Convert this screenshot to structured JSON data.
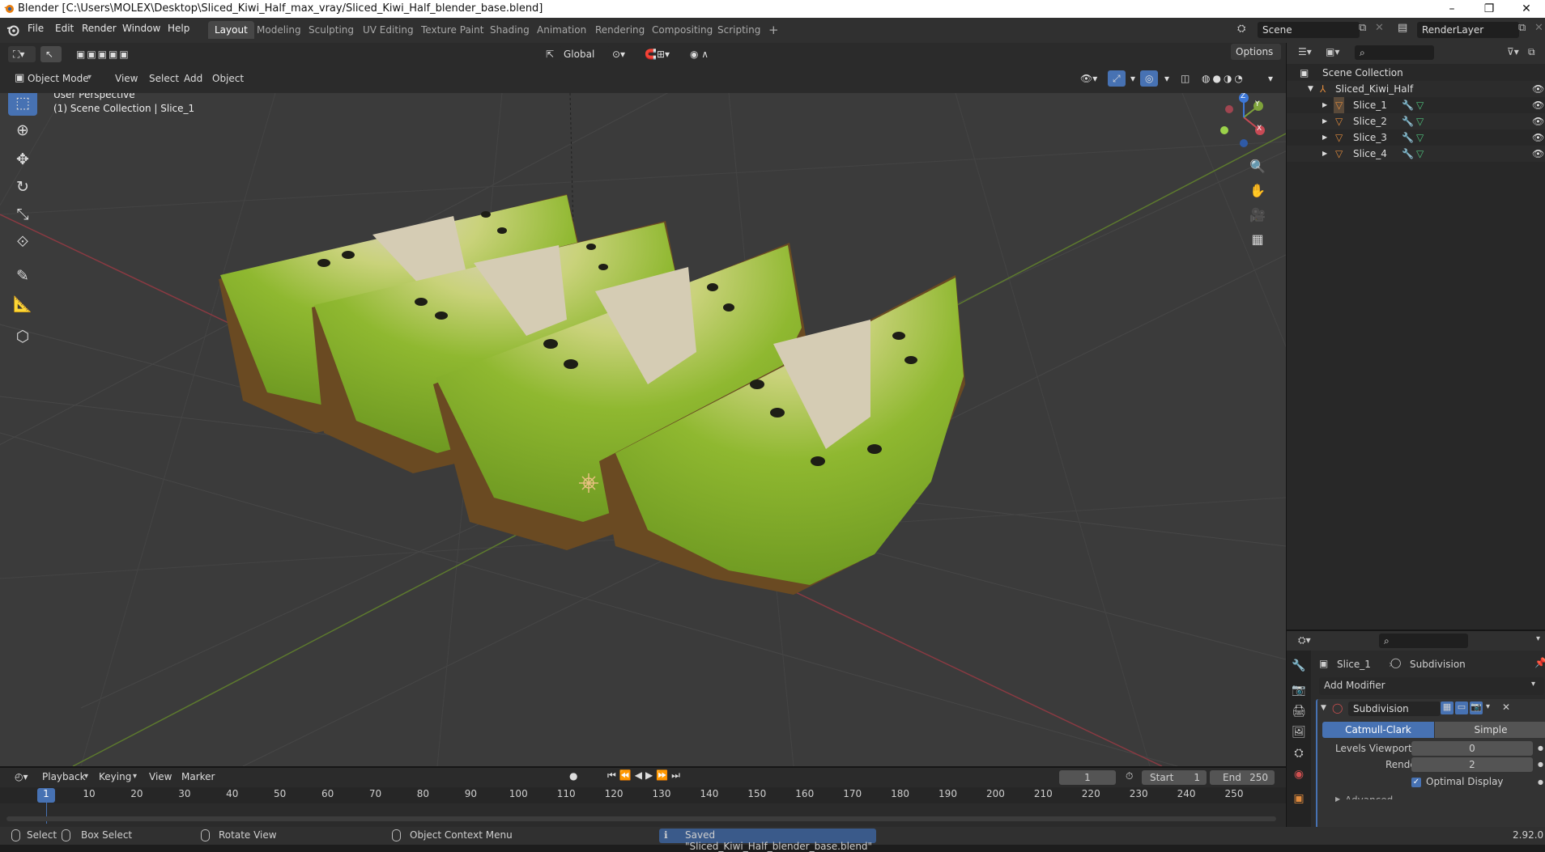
{
  "window": {
    "title": "Blender [C:\\Users\\MOLEX\\Desktop\\Sliced_Kiwi_Half_max_vray/Sliced_Kiwi_Half_blender_base.blend]",
    "controls": [
      "–",
      "❐",
      "✕"
    ]
  },
  "menu": [
    "File",
    "Edit",
    "Render",
    "Window",
    "Help"
  ],
  "workspaces": [
    {
      "label": "Layout",
      "active": true
    },
    {
      "label": "Modeling"
    },
    {
      "label": "Sculpting"
    },
    {
      "label": "UV Editing"
    },
    {
      "label": "Texture Paint"
    },
    {
      "label": "Shading"
    },
    {
      "label": "Animation"
    },
    {
      "label": "Rendering"
    },
    {
      "label": "Compositing"
    },
    {
      "label": "Scripting"
    }
  ],
  "add_workspace": "+",
  "scene": {
    "name": "Scene",
    "view_layer": "RenderLayer"
  },
  "viewport_header": {
    "transform_orientation": "Global",
    "options_label": "Options",
    "mode": "Object Mode",
    "menus": [
      "View",
      "Select",
      "Add",
      "Object"
    ]
  },
  "viewport": {
    "perspective": "User Perspective",
    "collection_info": "(1) Scene Collection | Slice_1",
    "gizmo_axes": [
      "X",
      "Y",
      "Z"
    ]
  },
  "outliner": {
    "root": "Scene Collection",
    "collection": "Sliced_Kiwi_Half",
    "objects": [
      "Slice_1",
      "Slice_2",
      "Slice_3",
      "Slice_4"
    ]
  },
  "properties": {
    "object_name": "Slice_1",
    "modifier_name_crumb": "Subdivision",
    "add_modifier": "Add Modifier",
    "modifier": {
      "name": "Subdivision",
      "types": [
        "Catmull-Clark",
        "Simple"
      ],
      "active_type": "Catmull-Clark",
      "levels_viewport_label": "Levels Viewport",
      "levels_viewport": "0",
      "render_label": "Render",
      "render": "2",
      "optimal_display_label": "Optimal Display",
      "optimal_display": true,
      "advanced_label": "Advanced"
    }
  },
  "timeline": {
    "menus": [
      "Playback",
      "Keying",
      "View",
      "Marker"
    ],
    "current_frame": "1",
    "start_label": "Start",
    "start": "1",
    "end_label": "End",
    "end": "250",
    "ticks": [
      "1",
      "10",
      "20",
      "30",
      "40",
      "50",
      "60",
      "70",
      "80",
      "90",
      "100",
      "110",
      "120",
      "130",
      "140",
      "150",
      "160",
      "170",
      "180",
      "190",
      "200",
      "210",
      "220",
      "230",
      "240",
      "250"
    ]
  },
  "statusbar": {
    "select": "Select",
    "box_select": "Box Select",
    "rotate_view": "Rotate View",
    "context_menu": "Object Context Menu",
    "message": "Saved \"Sliced_Kiwi_Half_blender_base.blend\"",
    "version": "2.92.0"
  },
  "colors": {
    "accent": "#4772b3",
    "viewport_bg": "#3b3b3b",
    "x_axis": "#c84a55",
    "y_axis": "#7fa33b",
    "z_axis": "#3d78d8",
    "object_orange": "#e08b3d",
    "message_bg": "#3a5a8a"
  }
}
